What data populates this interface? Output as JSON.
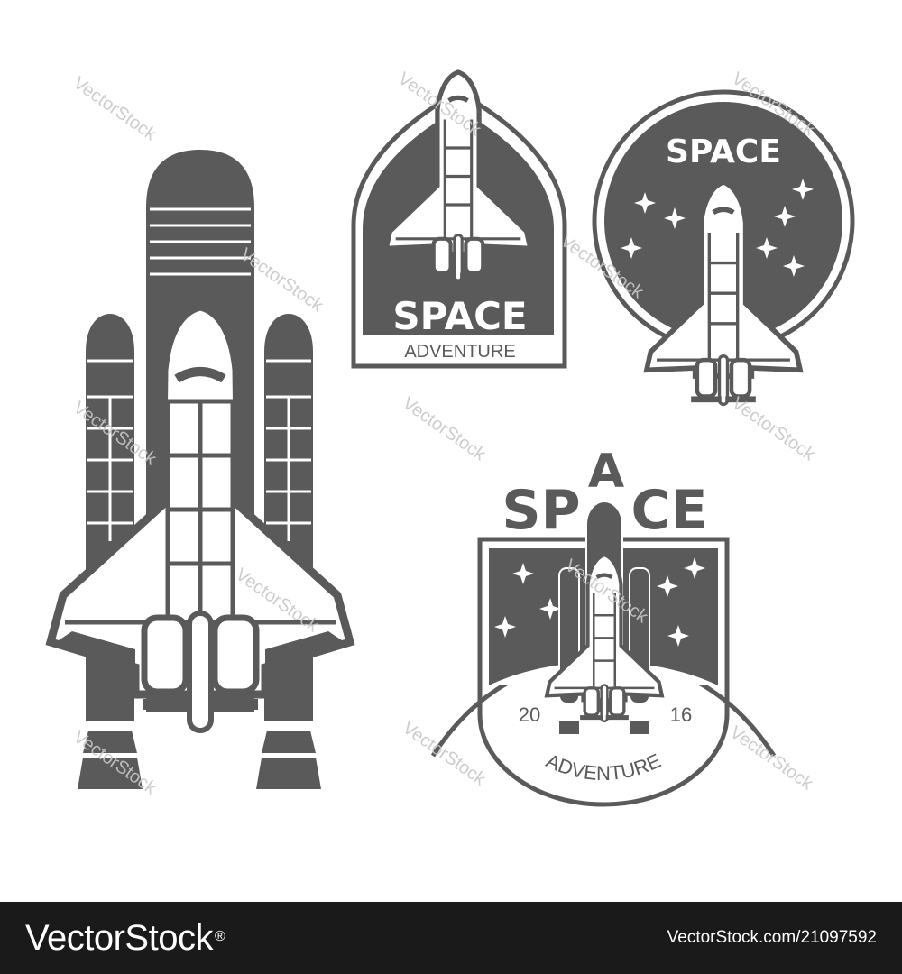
{
  "colors": {
    "ink": "#5a5a5a",
    "paper": "#ffffff",
    "footer_bg": "#1a1a1a",
    "footer_text": "#ffffff",
    "watermark": "#c8c8c8"
  },
  "badges": {
    "arch": {
      "title": "SPACE",
      "subtitle": "ADVENTURE"
    },
    "circle": {
      "title": "SPACE"
    },
    "square": {
      "title_left": "SP",
      "title_a": "A",
      "title_right": "CE",
      "year_left": "20",
      "year_right": "16",
      "subtitle": "ADVENTURE"
    }
  },
  "watermark_text": "VectorStock",
  "footer": {
    "brand": "VectorStock",
    "brand_mark": "®",
    "stock_id": "VectorStock.com/21097592"
  }
}
